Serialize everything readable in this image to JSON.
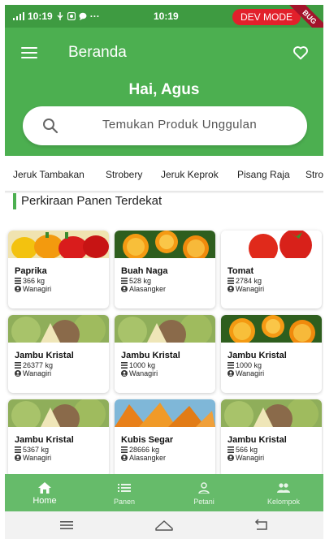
{
  "status": {
    "time_left": "10:19",
    "time_center": "10:19",
    "dev_mode": "DEV MODE",
    "ribbon": "BUG"
  },
  "header": {
    "title": "Beranda",
    "greeting": "Hai, Agus"
  },
  "search": {
    "placeholder": "Temukan Produk Unggulan"
  },
  "categories": [
    "Jeruk Tambakan",
    "Strobery",
    "Jeruk Keprok",
    "Pisang Raja",
    "Stro"
  ],
  "section": {
    "title": "Perkiraan Panen Terdekat"
  },
  "products": [
    {
      "name": "Paprika",
      "weight": "366 kg",
      "location": "Wanagiri",
      "image": "paprika"
    },
    {
      "name": "Buah Naga",
      "weight": "528 kg",
      "location": "Alasangker",
      "image": "orange"
    },
    {
      "name": "Tomat",
      "weight": "2784 kg",
      "location": "Wanagiri",
      "image": "tomato"
    },
    {
      "name": "Jambu Kristal",
      "weight": "26377 kg",
      "location": "Wanagiri",
      "image": "guava"
    },
    {
      "name": "Jambu Kristal",
      "weight": "1000 kg",
      "location": "Wanagiri",
      "image": "guava"
    },
    {
      "name": "Jambu Kristal",
      "weight": "1000 kg",
      "location": "Wanagiri",
      "image": "orange"
    },
    {
      "name": "Jambu Kristal",
      "weight": "5367 kg",
      "location": "Wanagiri",
      "image": "guava"
    },
    {
      "name": "Kubis Segar",
      "weight": "28666 kg",
      "location": "Alasangker",
      "image": "papaya"
    },
    {
      "name": "Jambu Kristal",
      "weight": "566 kg",
      "location": "Wanagiri",
      "image": "guava"
    }
  ],
  "nav": [
    {
      "label": "Home",
      "icon": "home-icon",
      "active": true
    },
    {
      "label": "Panen",
      "icon": "list-icon",
      "active": false
    },
    {
      "label": "Petani",
      "icon": "person-icon",
      "active": false
    },
    {
      "label": "Kelompok",
      "icon": "group-icon",
      "active": false
    }
  ],
  "colors": {
    "primary": "#4caf50",
    "status": "#3e9b41",
    "nav": "#66bb6a",
    "dev": "#e2202b"
  }
}
